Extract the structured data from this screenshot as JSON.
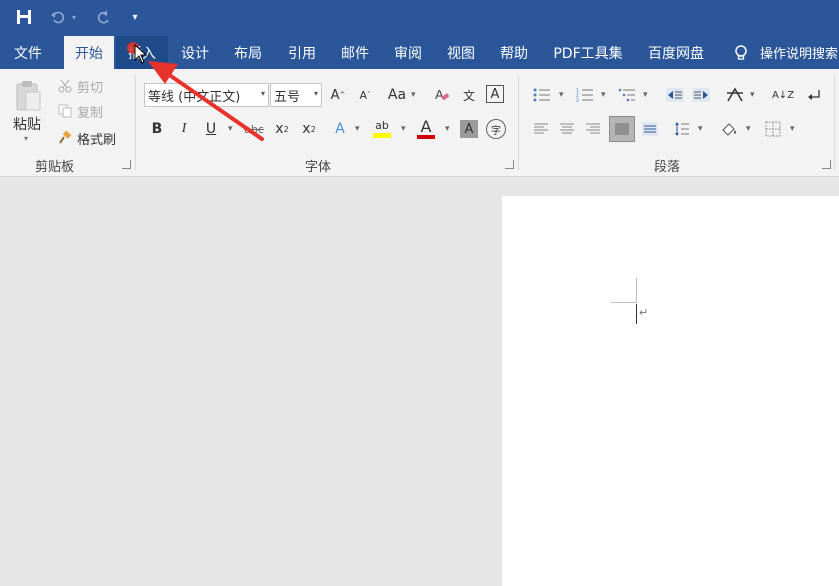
{
  "quick_access": {
    "save_icon": "save-icon",
    "undo_icon": "undo-icon",
    "redo_icon": "redo-icon",
    "customize_icon": "customize-qat-icon"
  },
  "tabs": [
    {
      "id": "file",
      "label": "文件"
    },
    {
      "id": "home",
      "label": "开始"
    },
    {
      "id": "insert",
      "label": "插入"
    },
    {
      "id": "design",
      "label": "设计"
    },
    {
      "id": "layout",
      "label": "布局"
    },
    {
      "id": "references",
      "label": "引用"
    },
    {
      "id": "mailings",
      "label": "邮件"
    },
    {
      "id": "review",
      "label": "审阅"
    },
    {
      "id": "view",
      "label": "视图"
    },
    {
      "id": "help",
      "label": "帮助"
    },
    {
      "id": "pdf",
      "label": "PDF工具集"
    },
    {
      "id": "baidu",
      "label": "百度网盘"
    }
  ],
  "tell_me": {
    "label": "操作说明搜索"
  },
  "clipboard": {
    "paste_label": "粘贴",
    "cut_label": "剪切",
    "copy_label": "复制",
    "format_painter_label": "格式刷",
    "group_label": "剪贴板"
  },
  "font": {
    "font_name": "等线 (中文正文)",
    "font_size": "五号",
    "grow_label": "A",
    "shrink_label": "A",
    "case_label": "Aa",
    "phonetic_label": "文",
    "border_label": "A",
    "bold_label": "B",
    "italic_label": "I",
    "underline_label": "U",
    "strike_label": "abc",
    "subscript_label": "x",
    "superscript_label": "x",
    "effects_label": "A",
    "highlight_label": "ab",
    "color_label": "A",
    "shading_label": "A",
    "enclose_label": "字",
    "group_label": "字体",
    "highlight_color": "#ffff00",
    "font_color": "#d00000"
  },
  "paragraph": {
    "group_label": "段落",
    "sort_label": "A↓Z"
  },
  "document": {
    "paragraph_mark": "↵"
  },
  "colors": {
    "brand": "#2b579a",
    "annotation_arrow": "#e8322c"
  }
}
